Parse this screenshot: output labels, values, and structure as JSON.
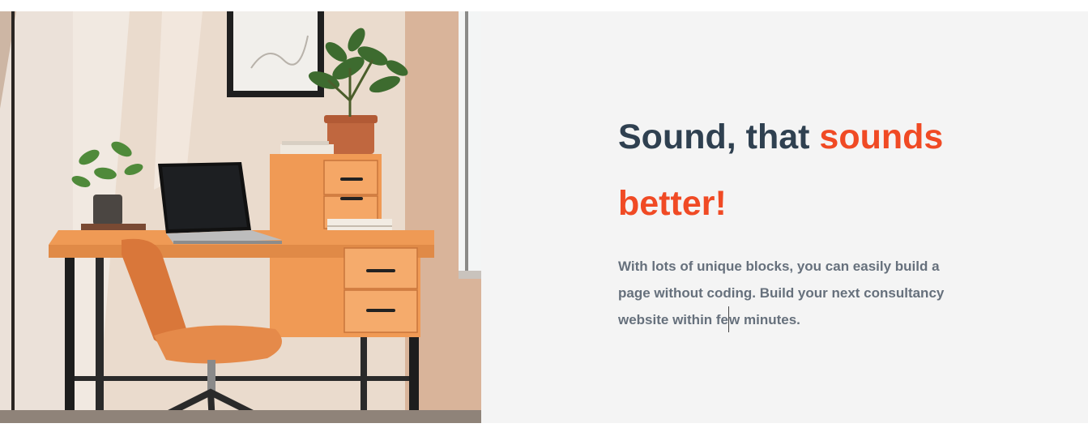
{
  "hero": {
    "heading_part1": "Sound, that ",
    "heading_accent": "sounds better!",
    "body_before_caret": "With lots of unique blocks, you can easily build a page without coding. Build your next consultancy website within fe",
    "body_after_caret": "w minutes.",
    "image_alt": "Home office desk with laptop, plants and orange chair"
  },
  "colors": {
    "heading": "#2f4050",
    "accent": "#f04a24",
    "body": "#66707c",
    "panel_background": "#f4f4f4"
  }
}
